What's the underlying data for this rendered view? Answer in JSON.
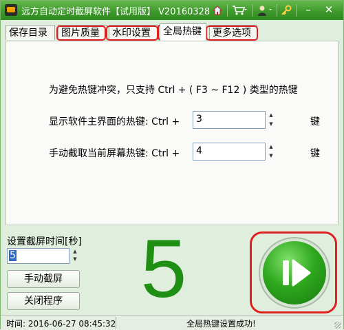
{
  "window": {
    "title": "远方自动定时截屏软件【试用版】 V20160328",
    "accent": "#3f9a2c",
    "highlight_color": "#e02020"
  },
  "titlebar": {
    "icons": [
      "home-icon",
      "cart-icon",
      "user-icon",
      "key-icon"
    ],
    "minimize_glyph": "–",
    "close_glyph": "✕"
  },
  "tabs": [
    {
      "label": "保存目录",
      "active": false
    },
    {
      "label": "图片质量",
      "active": false
    },
    {
      "label": "水印设置",
      "active": false
    },
    {
      "label": "全局热键",
      "active": true
    },
    {
      "label": "更多选项",
      "active": false
    }
  ],
  "hotkeys": {
    "notice": "为避免热键冲突，只支持 Ctrl + ( F3 ~ F12 ) 类型的热键",
    "main_label": "显示软件主界面的热键:  Ctrl +",
    "main_value": "3",
    "capture_label": "手动截取当前屏幕热键:  Ctrl +",
    "capture_value": "4",
    "key_suffix": "键"
  },
  "controls": {
    "interval_label": "设置截屏时间[秒]",
    "interval_value": "5",
    "manual_capture": "手动截屏",
    "close_program": "关闭程序",
    "countdown": "5"
  },
  "status": {
    "time": "时间: 2016-06-27 08:45:32",
    "message": "全局热键设置成功!"
  }
}
